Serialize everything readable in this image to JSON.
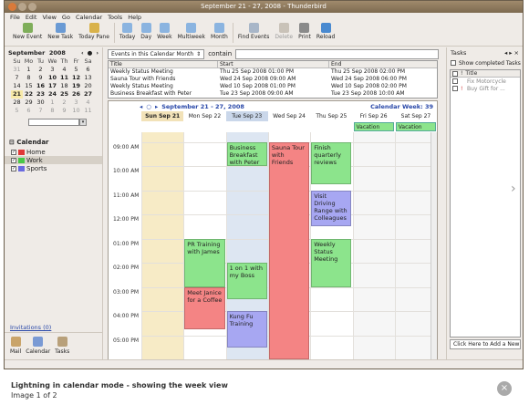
{
  "window": {
    "title": "September 21 - 27, 2008 - Thunderbird"
  },
  "menu": [
    "File",
    "Edit",
    "View",
    "Go",
    "Calendar",
    "Tools",
    "Help"
  ],
  "toolbar": {
    "buttons": [
      {
        "label": "New Event",
        "icon": "new-event-icon",
        "enabled": true
      },
      {
        "label": "New Task",
        "icon": "new-task-icon",
        "enabled": true
      },
      {
        "label": "Today Pane",
        "icon": "today-pane-icon",
        "enabled": true
      },
      {
        "label": "Today",
        "icon": "today-icon",
        "enabled": true
      },
      {
        "label": "Day",
        "icon": "day-view-icon",
        "enabled": true
      },
      {
        "label": "Week",
        "icon": "week-view-icon",
        "enabled": true
      },
      {
        "label": "Multiweek",
        "icon": "multiweek-view-icon",
        "enabled": true
      },
      {
        "label": "Month",
        "icon": "month-view-icon",
        "enabled": true
      },
      {
        "label": "Find Events",
        "icon": "find-events-icon",
        "enabled": true
      },
      {
        "label": "Delete",
        "icon": "delete-icon",
        "enabled": false
      },
      {
        "label": "Print",
        "icon": "print-icon",
        "enabled": true
      },
      {
        "label": "Reload",
        "icon": "reload-icon",
        "enabled": true
      }
    ]
  },
  "minimonth": {
    "month": "September",
    "year": "2008",
    "weekdays": [
      "Su",
      "Mo",
      "Tu",
      "We",
      "Th",
      "Fr",
      "Sa"
    ],
    "weeks": [
      [
        "31",
        "1",
        "2",
        "3",
        "4",
        "5",
        "6"
      ],
      [
        "7",
        "8",
        "9",
        "10",
        "11",
        "12",
        "13"
      ],
      [
        "14",
        "15",
        "16",
        "17",
        "18",
        "19",
        "20"
      ],
      [
        "21",
        "22",
        "23",
        "24",
        "25",
        "26",
        "27"
      ],
      [
        "28",
        "29",
        "30",
        "1",
        "2",
        "3",
        "4"
      ],
      [
        "5",
        "6",
        "7",
        "8",
        "9",
        "10",
        "11"
      ]
    ]
  },
  "calendars": {
    "title": "Calendar",
    "items": [
      {
        "name": "Home",
        "color": "#e03838",
        "checked": true
      },
      {
        "name": "Work",
        "color": "#48c848",
        "checked": true
      },
      {
        "name": "Sports",
        "color": "#6a6ae0",
        "checked": true
      }
    ]
  },
  "invitations": "Invitations (0)",
  "modes": [
    "Mail",
    "Calendar",
    "Tasks"
  ],
  "filter": {
    "select": "Events in this Calendar Month",
    "contains_label": "contain"
  },
  "eventlist": {
    "columns": [
      "Title",
      "Start",
      "End"
    ],
    "rows": [
      [
        "Weekly Status Meeting",
        "Thu 25 Sep 2008 01:00 PM",
        "Thu 25 Sep 2008 02:00 PM"
      ],
      [
        "Sauna Tour with Friends",
        "Wed 24 Sep 2008 09:00 AM",
        "Wed 24 Sep 2008 06:00 PM"
      ],
      [
        "Weekly Status Meeting",
        "Wed 10 Sep 2008 01:00 PM",
        "Wed 10 Sep 2008 02:00 PM"
      ],
      [
        "Business Breakfast with Peter",
        "Tue 23 Sep 2008 09:00 AM",
        "Tue 23 Sep 2008 10:00 AM"
      ]
    ]
  },
  "week": {
    "range": "September 21 - 27, 2008",
    "week_label": "Calendar Week: 39",
    "days": [
      "Sun Sep 21",
      "Mon Sep 22",
      "Tue Sep 23",
      "Wed Sep 24",
      "Thu Sep 25",
      "Fri Sep 26",
      "Sat Sep 27"
    ],
    "allday": [
      {
        "title": "Vacation",
        "day": 5
      },
      {
        "title": "Vacation",
        "day": 6
      }
    ],
    "times": [
      "09:00 AM",
      "10:00 AM",
      "11:00 AM",
      "12:00 PM",
      "01:00 PM",
      "02:00 PM",
      "03:00 PM",
      "04:00 PM",
      "05:00 PM"
    ],
    "events": [
      {
        "title": "Business Breakfast with Peter",
        "day": 2,
        "start": 9,
        "end": 10,
        "cal": "work"
      },
      {
        "title": "Sauna Tour with Friends",
        "day": 3,
        "start": 9,
        "end": 18,
        "cal": "home"
      },
      {
        "title": "Finish quarterly reviews",
        "day": 4,
        "start": 9,
        "end": 10.75,
        "cal": "work"
      },
      {
        "title": "Visit Driving Range with Colleagues",
        "day": 4,
        "start": 11,
        "end": 12.5,
        "cal": "sports"
      },
      {
        "title": "PR Training with James",
        "day": 1,
        "start": 13,
        "end": 15,
        "cal": "work"
      },
      {
        "title": "Weekly Status Meeting",
        "day": 4,
        "start": 13,
        "end": 15,
        "cal": "work"
      },
      {
        "title": "1 on 1 with my Boss",
        "day": 2,
        "start": 14,
        "end": 15.5,
        "cal": "work"
      },
      {
        "title": "Meet Janice for a Coffee",
        "day": 1,
        "start": 15,
        "end": 16.75,
        "cal": "home"
      },
      {
        "title": "Kung Fu Training",
        "day": 2,
        "start": 16,
        "end": 17.5,
        "cal": "sports"
      }
    ]
  },
  "tasks": {
    "title": "Tasks",
    "show_completed": "Show completed Tasks",
    "columns": [
      "!",
      "Title"
    ],
    "items": [
      "Fix Motorcycle",
      "Buy Gift for ..."
    ],
    "add_label": "Click Here to Add a New"
  },
  "caption": {
    "title": "Lightning in calendar mode - showing the week view",
    "counter": "Image 1 of 2"
  }
}
